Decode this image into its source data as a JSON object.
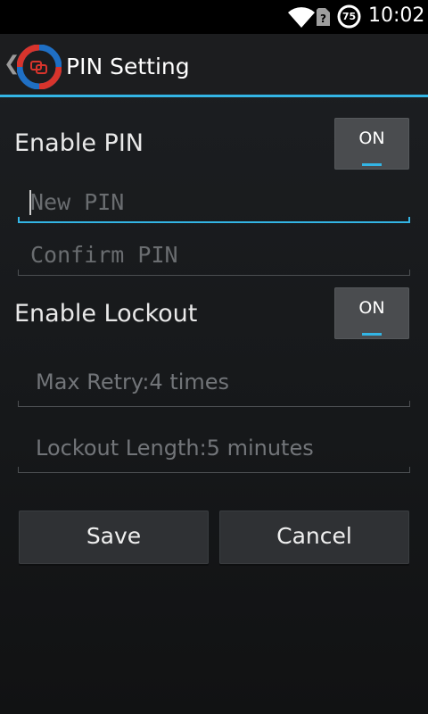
{
  "status_bar": {
    "time": "10:02",
    "battery_level": "75",
    "wifi_icon": "wifi-icon",
    "sim_icon": "no-sim-icon"
  },
  "action_bar": {
    "title": "PIN Setting",
    "up_icon": "chevron-left-icon",
    "logo_icon": "app-logo-icon",
    "accent_color": "#33b5e5"
  },
  "enable_pin": {
    "label": "Enable PIN",
    "toggle_label": "ON"
  },
  "new_pin": {
    "placeholder": "New PIN"
  },
  "confirm_pin": {
    "placeholder": "Confirm PIN"
  },
  "enable_lockout": {
    "label": "Enable Lockout",
    "toggle_label": "ON"
  },
  "max_retry": {
    "text": "Max Retry:4 times"
  },
  "lockout_length": {
    "text": "Lockout Length:5 minutes"
  },
  "buttons": {
    "save": "Save",
    "cancel": "Cancel"
  }
}
